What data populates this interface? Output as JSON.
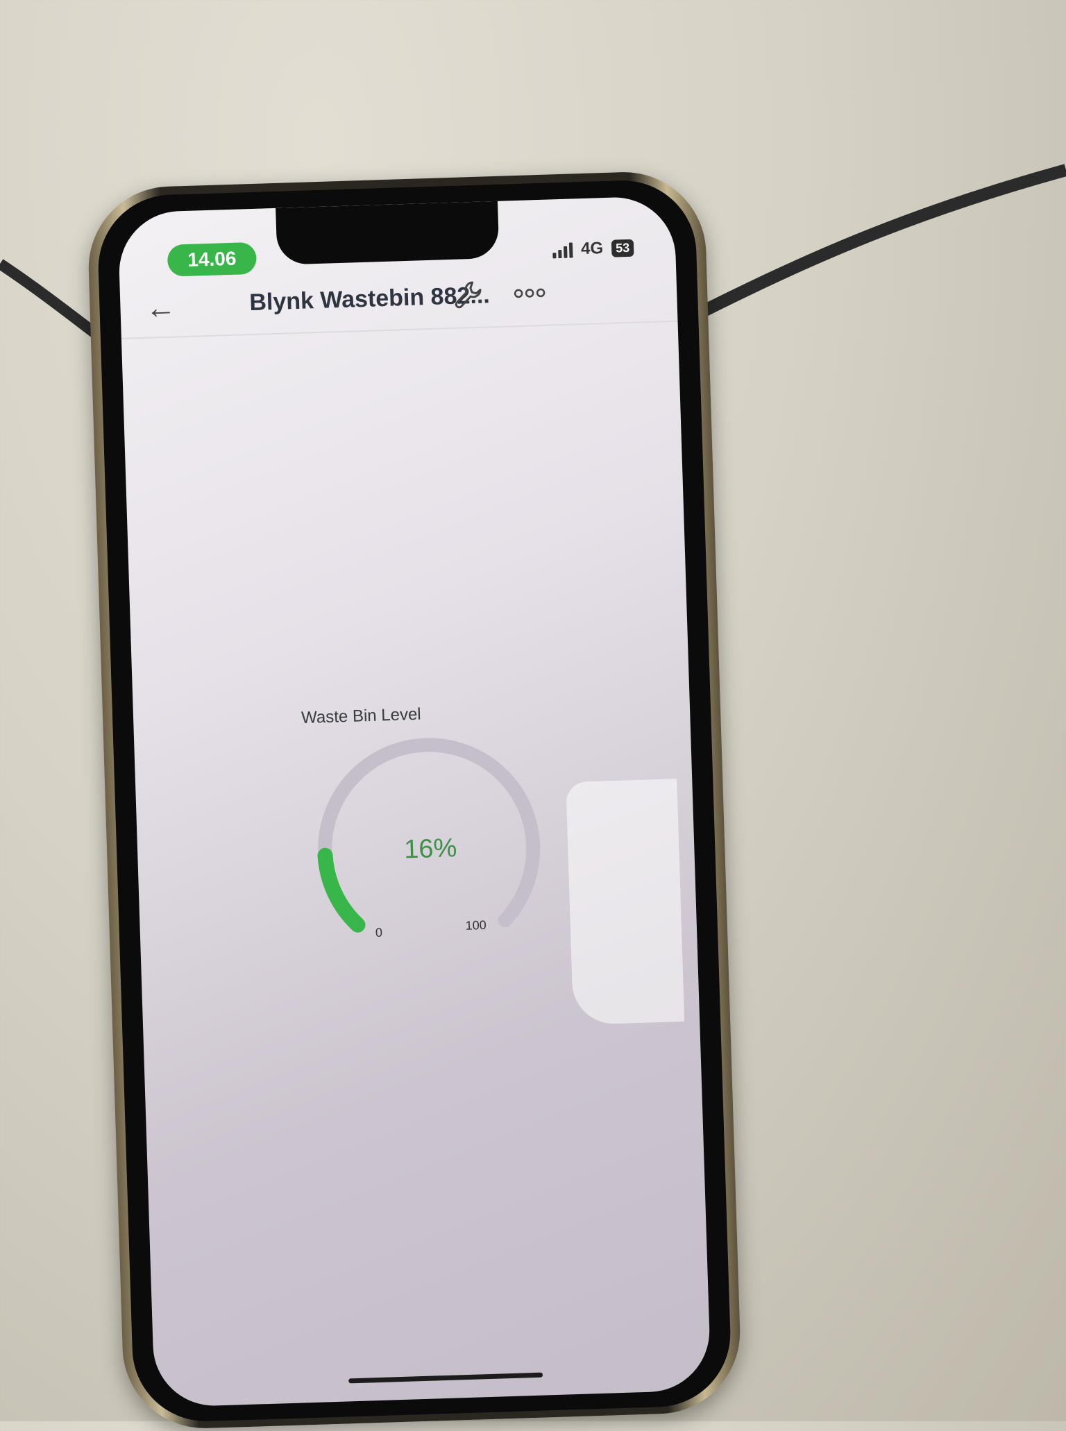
{
  "status_bar": {
    "time": "14.06",
    "network": "4G",
    "battery": "53"
  },
  "header": {
    "title": "Blynk Wastebin 882..."
  },
  "widget": {
    "label": "Waste Bin Level",
    "value_text": "16%",
    "min_label": "0",
    "max_label": "100",
    "value_percent": 16
  },
  "icons": [
    "back-arrow-icon",
    "wrench-icon",
    "more-icon",
    "signal-icon"
  ],
  "colors": {
    "accent_green": "#38b64a",
    "gauge_track": "#c4bfca",
    "value_text": "#3f8f48"
  }
}
